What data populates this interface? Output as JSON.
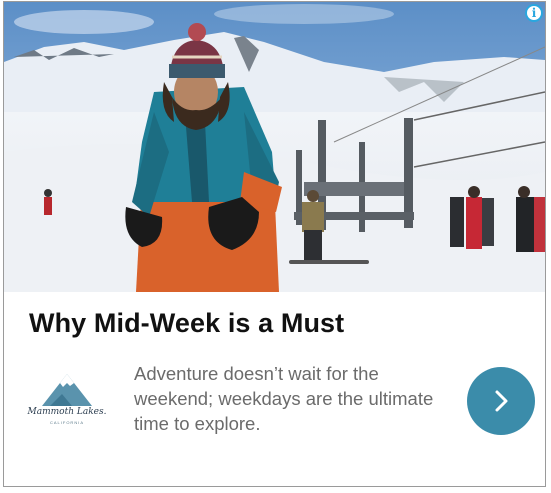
{
  "ad": {
    "headline": "Why Mid-Week is a Must",
    "body": "Adventure doesn’t wait for the weekend; weekdays are the ultimate time to explore.",
    "info_icon": "info-icon",
    "info_glyph": "i",
    "cta_icon": "chevron-right-icon"
  },
  "logo": {
    "brand": "Mammoth Lakes.",
    "sub": "CALIFORNIA"
  },
  "colors": {
    "cta": "#3b8caa",
    "info": "#2aa7df",
    "headline": "#111111",
    "body": "#6b6b6b"
  }
}
